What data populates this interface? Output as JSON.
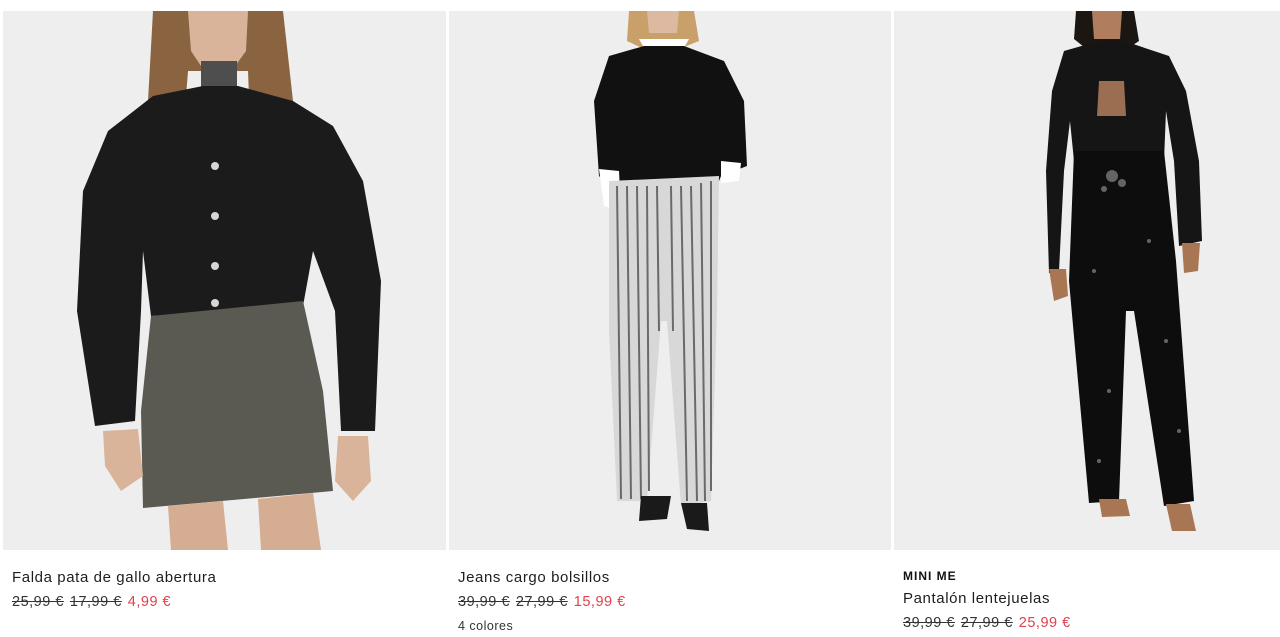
{
  "products": [
    {
      "name": "Falda pata de gallo abertura",
      "prices": {
        "original": "25,99 €",
        "previous": "17,99 €",
        "current": "4,99 €"
      },
      "image": "woman-black-leather-jacket-grey-skirt"
    },
    {
      "name": "Jeans cargo bolsillos",
      "prices": {
        "original": "39,99 €",
        "previous": "27,99 €",
        "current": "15,99 €"
      },
      "colors": "4 colores",
      "image": "woman-black-sweater-striped-jeans"
    },
    {
      "tag": "MINI ME",
      "name": "Pantalón lentejuelas",
      "prices": {
        "original": "39,99 €",
        "previous": "27,99 €",
        "current": "25,99 €"
      },
      "image": "woman-sheer-black-shirt-sequin-trousers"
    }
  ],
  "colors": {
    "sale": "#e0414b",
    "photo_bg": "#eeeeee",
    "text": "#1e1e1e"
  }
}
